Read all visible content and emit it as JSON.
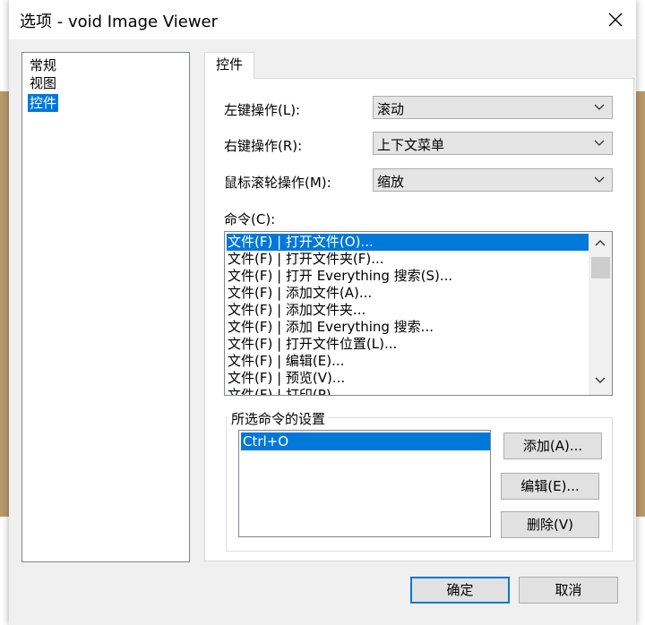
{
  "window": {
    "title": "选项 - void Image Viewer"
  },
  "nav": {
    "items": [
      "常规",
      "视图",
      "控件"
    ],
    "selected_index": 2
  },
  "tab": {
    "label": "控件"
  },
  "fields": {
    "left_click": {
      "label": "左键操作(L):",
      "value": "滚动"
    },
    "right_click": {
      "label": "右键操作(R):",
      "value": "上下文菜单"
    },
    "wheel": {
      "label": "鼠标滚轮操作(M):",
      "value": "缩放"
    }
  },
  "commands": {
    "label": "命令(C):",
    "items": [
      "文件(F) | 打开文件(O)...",
      "文件(F) | 打开文件夹(F)...",
      "文件(F) | 打开 Everything 搜索(S)...",
      "文件(F) | 添加文件(A)...",
      "文件(F) | 添加文件夹...",
      "文件(F) | 添加 Everything 搜索...",
      "文件(F) | 打开文件位置(L)...",
      "文件(F) | 编辑(E)...",
      "文件(F) | 预览(V)...",
      "文件(F) | 打印(P)..."
    ],
    "selected_index": 0
  },
  "settings": {
    "title": "所选命令的设置",
    "keys": [
      "Ctrl+O"
    ],
    "add": "添加(A)...",
    "edit": "编辑(E)...",
    "delete": "删除(V)"
  },
  "footer": {
    "ok": "确定",
    "cancel": "取消"
  },
  "colors": {
    "selection": "#0078d7",
    "dialog_bg": "#f0f0f0"
  }
}
